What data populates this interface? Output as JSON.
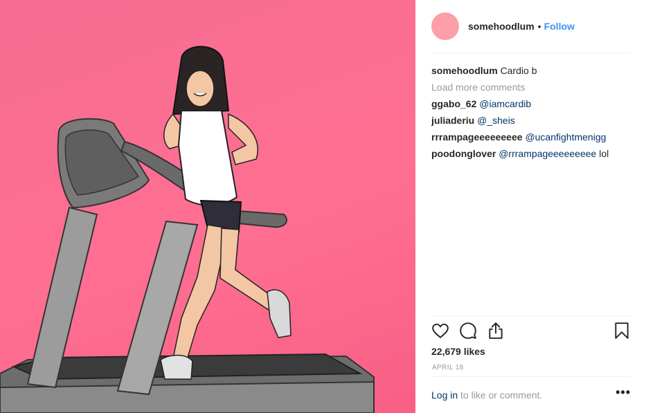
{
  "post": {
    "username": "somehoodlum",
    "separator": "•",
    "follow_label": "Follow",
    "avatar_color": "#fd9fa8",
    "image_bg_color": "#ff6f91"
  },
  "comments": {
    "caption": {
      "user": "somehoodlum",
      "text": "Cardio b"
    },
    "load_more": "Load more comments",
    "items": [
      {
        "user": "ggabo_62",
        "text": "@iamcardib"
      },
      {
        "user": "juliaderiu",
        "text": "@_sheis"
      },
      {
        "user": "rrrampageeeeeeeee",
        "text": "@ucanfightmenigg"
      },
      {
        "user": "poodonglover",
        "text": "@rrrampageeeeeeeee",
        "suffix": "lol"
      }
    ]
  },
  "actions": {
    "icons": [
      "heart-icon",
      "comment-icon",
      "share-icon",
      "bookmark-icon"
    ],
    "likes": "22,679 likes",
    "date": "APRIL 18"
  },
  "footer": {
    "login_link": "Log in",
    "login_text": "to like or comment.",
    "more_label": "•••"
  },
  "colors": {
    "link_blue": "#3897f0",
    "mention_blue": "#003569",
    "muted_gray": "#999999"
  }
}
